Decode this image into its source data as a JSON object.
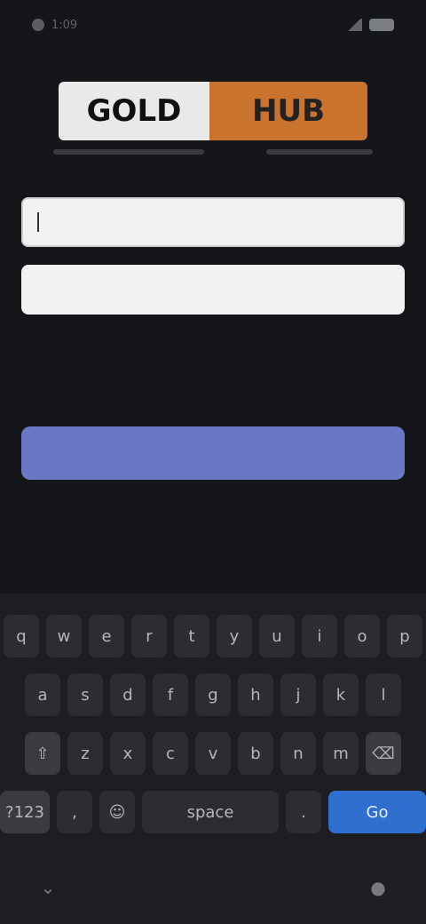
{
  "status_bar": {
    "time": "1:09"
  },
  "logo": {
    "left": "GOLD",
    "right": "HUB"
  },
  "tagline": {
    "left": "",
    "right": ""
  },
  "form": {
    "username_placeholder": "",
    "password_placeholder": "",
    "hint_text": "",
    "forgot_text": "",
    "login_label": "",
    "signup_text": ""
  },
  "keyboard": {
    "row1": [
      "q",
      "w",
      "e",
      "r",
      "t",
      "y",
      "u",
      "i",
      "o",
      "p"
    ],
    "row2": [
      "a",
      "s",
      "d",
      "f",
      "g",
      "h",
      "j",
      "k",
      "l"
    ],
    "row3": [
      "⇧",
      "z",
      "x",
      "c",
      "v",
      "b",
      "n",
      "m",
      "⌫"
    ],
    "row4": [
      "?123",
      ",",
      "☺",
      "space",
      ".",
      "Go"
    ]
  },
  "nav": {
    "left_icon": "keyboard-down-icon",
    "right_icon": "mic-icon"
  },
  "colors": {
    "accent": "#6a77c4",
    "go_key": "#2f6fcf",
    "logo_orange": "#c9732f"
  }
}
